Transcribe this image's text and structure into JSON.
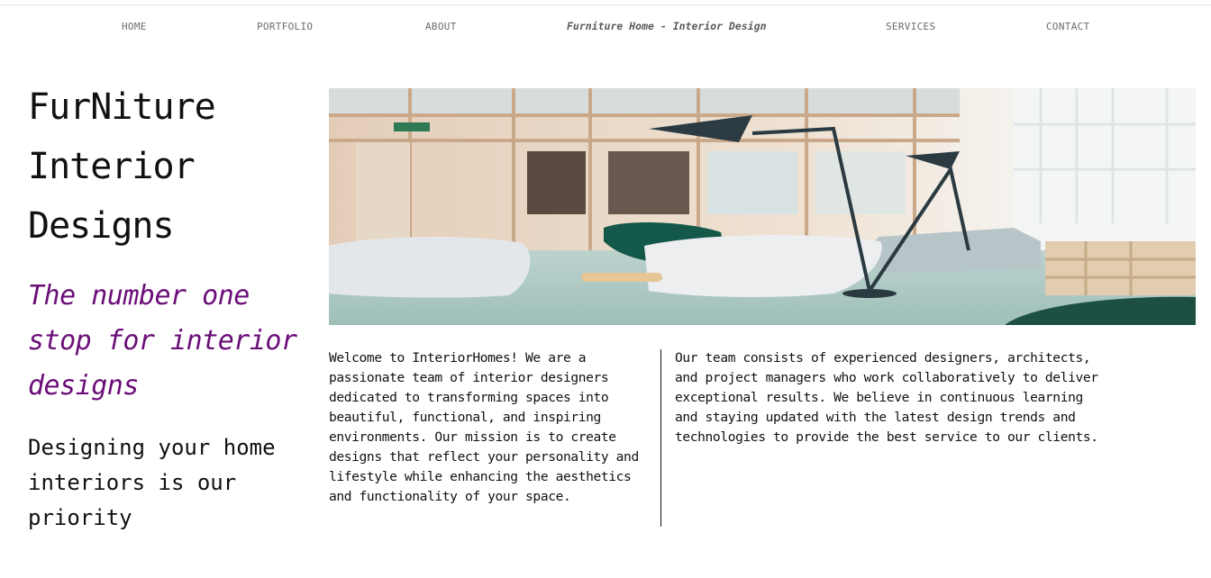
{
  "nav": {
    "home": "HOME",
    "portfolio": "PORTFOLIO",
    "about": "ABOUT",
    "brand": "Furniture Home - Interior Design",
    "services": "SERVICES",
    "contact": "CONTACT"
  },
  "hero": {
    "title_line1": "FurNiture",
    "title_line2": "Interior",
    "title_line3": "Designs",
    "tagline": "The number one stop for interior designs",
    "priority": "Designing your home interiors is our priority"
  },
  "about": {
    "paragraph1": "Welcome to InteriorHomes! We are a passionate team of interior designers dedicated to transforming spaces into beautiful, functional, and inspiring environments. Our mission is to create designs that reflect your personality and lifestyle while enhancing the aesthetics and functionality of your space.",
    "paragraph2": "Our team consists of experienced designers, architects, and project managers who work collaboratively to deliver exceptional results. We believe in continuous learning and staying updated with the latest design trends and technologies to provide the best service to our clients."
  },
  "colors": {
    "tagline": "#6b0f78",
    "nav_text": "#6b6b6b",
    "text": "#111111"
  },
  "image": {
    "subject": "modern office lounge with white chairs, green chair and black floor lamp"
  }
}
